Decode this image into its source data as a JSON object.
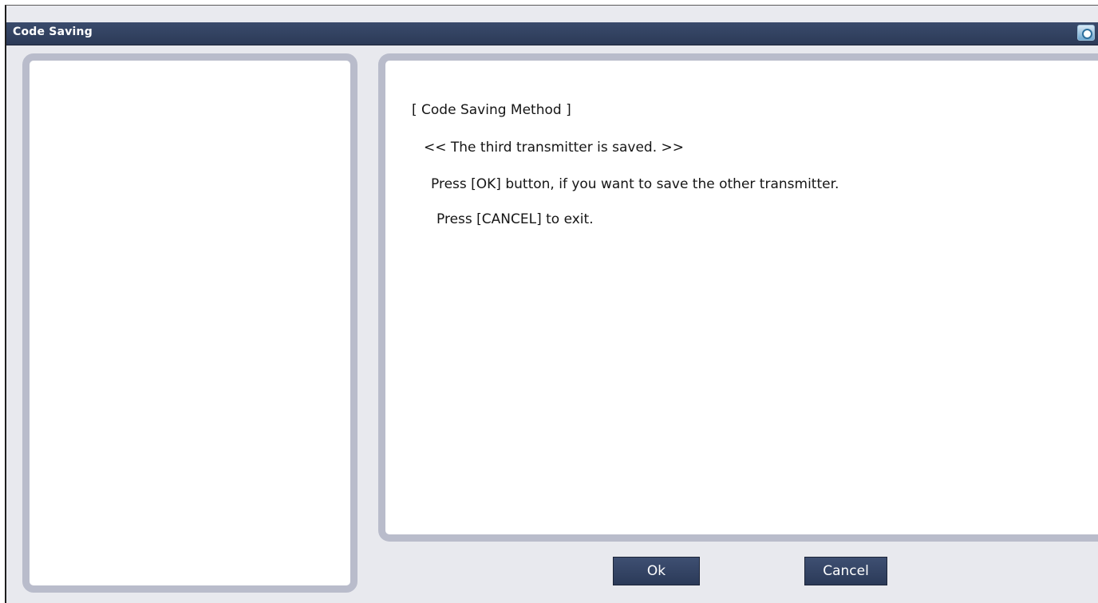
{
  "window": {
    "title": "Code Saving",
    "title_icon": "camera-icon"
  },
  "message": {
    "heading": "[ Code Saving Method ]",
    "saved_notice": "<< The third transmitter is saved. >>",
    "ok_instruction": "Press [OK] button, if you want to save the other transmitter.",
    "cancel_instruction": "Press [CANCEL] to exit."
  },
  "buttons": {
    "ok_label": "Ok",
    "cancel_label": "Cancel"
  },
  "colors": {
    "title_bar": "#2f3e5d",
    "button": "#34456a",
    "panel_border": "#b9bccb",
    "background": "#e8e9ee"
  }
}
